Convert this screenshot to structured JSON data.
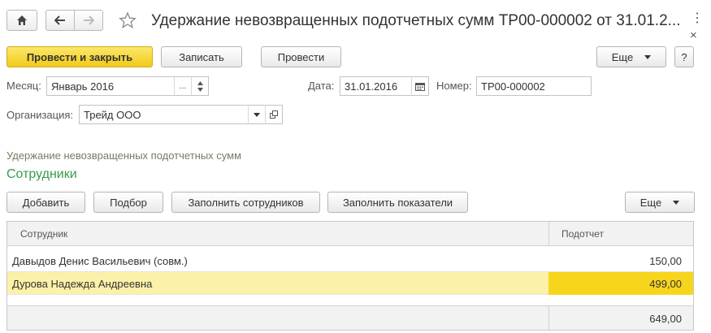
{
  "window": {
    "title": "Удержание невозвращенных подотчетных сумм ТР00-000002 от 31.01.2...",
    "more_icon": "kebab-icon",
    "close_icon": "close-icon"
  },
  "toolbar": {
    "post_close_label": "Провести и закрыть",
    "save_label": "Записать",
    "post_label": "Провести",
    "more_label": "Еще",
    "help_label": "?"
  },
  "form": {
    "month_label": "Месяц:",
    "month_value": "Январь 2016",
    "date_label": "Дата:",
    "date_value": "31.01.2016",
    "number_label": "Номер:",
    "number_value": "ТР00-000002",
    "org_label": "Организация:",
    "org_value": "Трейд ООО"
  },
  "section_caption": "Удержание невозвращенных подотчетных сумм",
  "employees": {
    "title": "Сотрудники",
    "add_label": "Добавить",
    "select_label": "Подбор",
    "fill_employees_label": "Заполнить сотрудников",
    "fill_indicators_label": "Заполнить показатели",
    "more_label": "Еще",
    "columns": [
      "Сотрудник",
      "Подотчет"
    ],
    "rows": [
      {
        "employee": "Давыдов Денис Васильевич (совм.)",
        "amount": "150,00"
      },
      {
        "employee": "Дурова Надежда Андреевна",
        "amount": "499,00",
        "selected": true
      }
    ],
    "total": "649,00"
  }
}
